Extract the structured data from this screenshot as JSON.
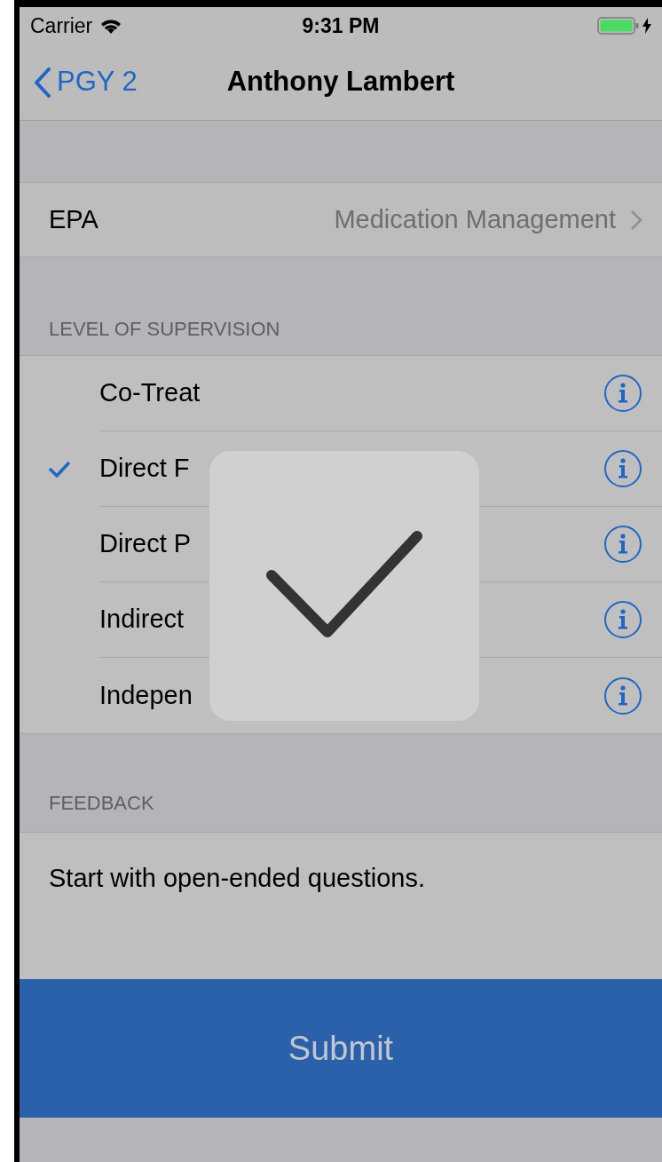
{
  "status_bar": {
    "carrier": "Carrier",
    "time": "9:31 PM"
  },
  "nav": {
    "back": "PGY 2",
    "title": "Anthony Lambert"
  },
  "epa": {
    "label": "EPA",
    "value": "Medication Management"
  },
  "supervision": {
    "header": "LEVEL OF SUPERVISION",
    "options": [
      {
        "label": "Co-Treat",
        "selected": false
      },
      {
        "label": "Direct F",
        "selected": true
      },
      {
        "label": "Direct P",
        "selected": false
      },
      {
        "label": "Indirect",
        "selected": false
      },
      {
        "label": "Indepen",
        "selected": false
      }
    ]
  },
  "feedback": {
    "header": "FEEDBACK",
    "value": "Start with open-ended questions."
  },
  "submit": "Submit"
}
